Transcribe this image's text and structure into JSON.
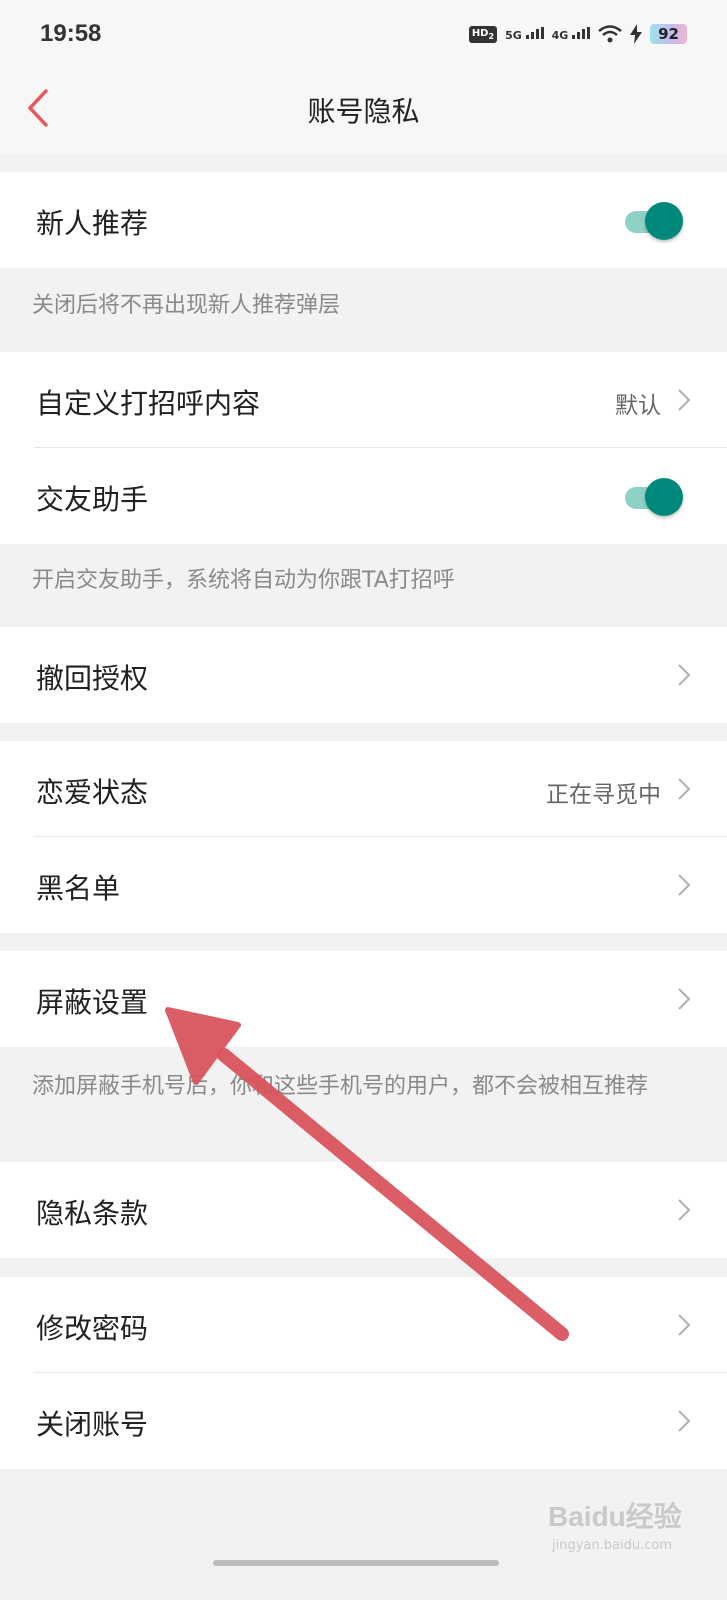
{
  "status_bar": {
    "time": "19:58",
    "hd_label": "HD",
    "hd_sub": "2",
    "net1": "5G",
    "net2": "4G",
    "battery": "92",
    "icons": [
      "hd-voice-icon",
      "signal-5g-icon",
      "signal-4g-icon",
      "wifi-icon",
      "charging-icon",
      "battery-icon"
    ]
  },
  "nav": {
    "title": "账号隐私",
    "back_icon": "chevron-left-icon"
  },
  "accent_color": "#e85a5a",
  "toggle_color": "#00897b",
  "sections": {
    "recommend": {
      "label": "新人推荐",
      "toggle_on": true,
      "hint": "关闭后将不再出现新人推荐弹层"
    },
    "greeting": {
      "label": "自定义打招呼内容",
      "value": "默认"
    },
    "assistant": {
      "label": "交友助手",
      "toggle_on": true,
      "hint": "开启交友助手，系统将自动为你跟TA打招呼"
    },
    "revoke": {
      "label": "撤回授权"
    },
    "relationship": {
      "label": "恋爱状态",
      "value": "正在寻觅中"
    },
    "blacklist": {
      "label": "黑名单"
    },
    "block": {
      "label": "屏蔽设置",
      "hint": "添加屏蔽手机号后，你和这些手机号的用户，都不会被相互推荐"
    },
    "privacy": {
      "label": "隐私条款"
    },
    "password": {
      "label": "修改密码"
    },
    "close_account": {
      "label": "关闭账号"
    }
  },
  "watermark": {
    "brand": "Baidu经验",
    "url": "jingyan.baidu.com"
  }
}
